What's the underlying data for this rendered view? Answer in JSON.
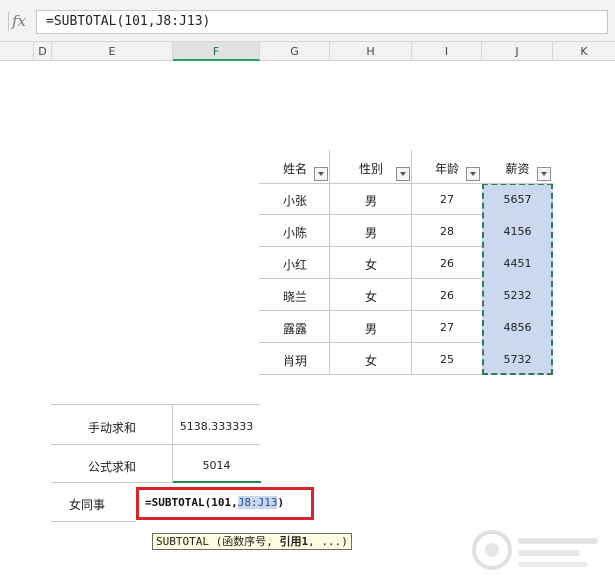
{
  "formula_bar": {
    "fx_label": "fx",
    "formula": "=SUBTOTAL(101,J8:J13)"
  },
  "columns": [
    "D",
    "E",
    "F",
    "G",
    "H",
    "I",
    "J",
    "K"
  ],
  "active_column": "F",
  "table": {
    "headers": [
      "姓名",
      "性别",
      "年龄",
      "薪资"
    ],
    "rows": [
      [
        "小张",
        "男",
        "27",
        "5657"
      ],
      [
        "小陈",
        "男",
        "28",
        "4156"
      ],
      [
        "小红",
        "女",
        "26",
        "4451"
      ],
      [
        "晓兰",
        "女",
        "26",
        "5232"
      ],
      [
        "露露",
        "男",
        "27",
        "4856"
      ],
      [
        "肖玥",
        "女",
        "25",
        "5732"
      ]
    ]
  },
  "summary": {
    "manual_label": "手动求和",
    "manual_value": "5138.333333",
    "formula_label": "公式求和",
    "formula_value": "5014",
    "female_label": "女同事"
  },
  "editing": {
    "prefix": "=SUBTOTAL(101,",
    "ref": "J8:J13",
    "suffix": ")"
  },
  "tooltip": {
    "func": "SUBTOTAL",
    "args_open": " (函数序号, ",
    "arg_bold": "引用1",
    "args_close": ", ...)"
  },
  "colors": {
    "selection_fill": "#ccd8ef",
    "selection_border": "#2d7d53",
    "highlight_box": "#d9242a",
    "active_col": "#21a366"
  }
}
